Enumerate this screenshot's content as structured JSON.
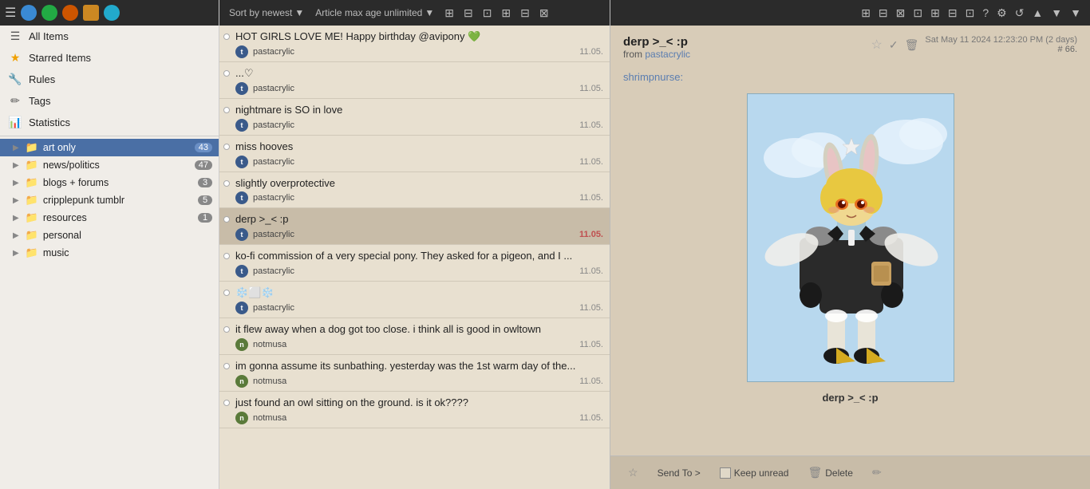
{
  "sidebar": {
    "nav_items": [
      {
        "id": "all-items",
        "label": "All Items",
        "icon": "☰",
        "icon_name": "all-items-icon"
      },
      {
        "id": "starred",
        "label": "Starred Items",
        "icon": "★",
        "icon_name": "star-icon"
      },
      {
        "id": "rules",
        "label": "Rules",
        "icon": "🔧",
        "icon_name": "rules-icon"
      },
      {
        "id": "tags",
        "label": "Tags",
        "icon": "✏",
        "icon_name": "tags-icon"
      },
      {
        "id": "statistics",
        "label": "Statistics",
        "icon": "📊",
        "icon_name": "statistics-icon"
      }
    ],
    "feeds": [
      {
        "id": "art-only",
        "label": "art only",
        "count": "43",
        "active": true,
        "indent": 1
      },
      {
        "id": "news-politics",
        "label": "news/politics",
        "count": "47",
        "active": false,
        "indent": 1
      },
      {
        "id": "blogs-forums",
        "label": "blogs + forums",
        "count": "3",
        "active": false,
        "indent": 1
      },
      {
        "id": "cripplepunk-tumblr",
        "label": "cripplepunk tumblr",
        "count": "5",
        "active": false,
        "indent": 1
      },
      {
        "id": "resources",
        "label": "resources",
        "count": "1",
        "active": false,
        "indent": 1
      },
      {
        "id": "personal",
        "label": "personal",
        "count": "",
        "active": false,
        "indent": 1
      },
      {
        "id": "music",
        "label": "music",
        "count": "",
        "active": false,
        "indent": 1
      }
    ]
  },
  "toolbar": {
    "sort_label": "Sort by newest",
    "age_label": "Article max age unlimited",
    "icons": [
      "⊞",
      "⊟",
      "⊠",
      "⊡",
      "⊞",
      "⊟",
      "⊡",
      "?",
      "⚙",
      "↺",
      "▲",
      "▼"
    ]
  },
  "articles": [
    {
      "id": 1,
      "title": "HOT GIRLS LOVE ME! Happy birthday @avipony 💚",
      "author": "pastacrylic",
      "date": "11.05.",
      "selected": false,
      "date_highlight": false
    },
    {
      "id": 2,
      "title": "...♡",
      "author": "pastacrylic",
      "date": "11.05.",
      "selected": false,
      "date_highlight": false
    },
    {
      "id": 3,
      "title": "nightmare is SO in love",
      "author": "pastacrylic",
      "date": "11.05.",
      "selected": false,
      "date_highlight": false
    },
    {
      "id": 4,
      "title": "miss hooves",
      "author": "pastacrylic",
      "date": "11.05.",
      "selected": false,
      "date_highlight": false
    },
    {
      "id": 5,
      "title": "slightly overprotective",
      "author": "pastacrylic",
      "date": "11.05.",
      "selected": false,
      "date_highlight": false
    },
    {
      "id": 6,
      "title": "derp >_< :p",
      "author": "pastacrylic",
      "date": "11.05.",
      "selected": true,
      "date_highlight": true
    },
    {
      "id": 7,
      "title": "ko-fi commission of a very special pony. They asked for a pigeon, and I ...",
      "author": "pastacrylic",
      "date": "11.05.",
      "selected": false,
      "date_highlight": false
    },
    {
      "id": 8,
      "title": "❄️⬜❄️",
      "author": "pastacrylic",
      "date": "11.05.",
      "selected": false,
      "date_highlight": false
    },
    {
      "id": 9,
      "title": "it flew away when a dog got too close. i think all is good in owltown",
      "author": "notmusa",
      "date": "11.05.",
      "selected": false,
      "date_highlight": false
    },
    {
      "id": 10,
      "title": "im gonna assume its sunbathing. yesterday was the 1st warm day of the...",
      "author": "notmusa",
      "date": "11.05.",
      "selected": false,
      "date_highlight": false
    },
    {
      "id": 11,
      "title": "just found an owl sitting on the ground. is it ok????",
      "author": "notmusa",
      "date": "11.05.",
      "selected": false,
      "date_highlight": false
    }
  ],
  "article_view": {
    "title": "derp >_< :p",
    "from_label": "from",
    "from_author": "pastacrylic",
    "date": "Sat May 11 2024 12:23:20 PM",
    "date_ago": "(2 days)",
    "article_num": "# 66.",
    "body_link": "shrimpnurse:",
    "summary_title": "derp >_< :p",
    "footer": {
      "send_to_label": "Send To >",
      "keep_unread_label": "Keep unread",
      "delete_label": "Delete"
    }
  }
}
